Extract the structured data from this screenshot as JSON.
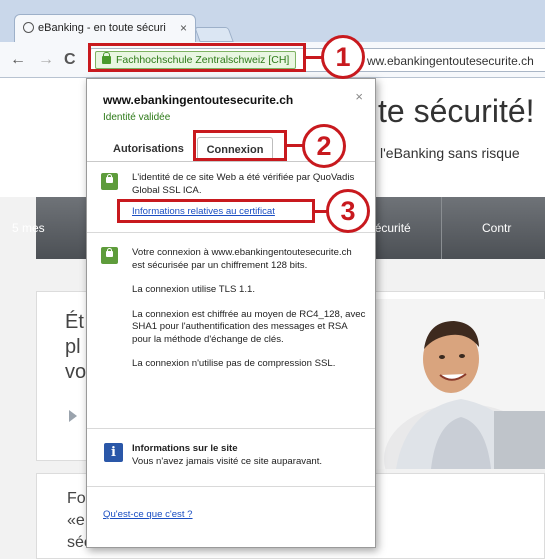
{
  "browser": {
    "tab_title": "eBanking - en toute sécuri",
    "tab_close": "×",
    "ev_label": "Fachhochschule Zentralschweiz [CH]",
    "url_visible": "ww.ebankingentoutesecurite.ch"
  },
  "page": {
    "title": "te sécurité!",
    "subtitle": "l'eBanking sans risque",
    "nav_left": "5 mes",
    "nav_mid": "n à la sécurité",
    "nav_right": "Contr",
    "hero_line1": "Ét",
    "hero_line2": "pl",
    "hero_line3": "vo",
    "section2_line1": "Fo",
    "section2_line2": "«e",
    "section2_line3": "sécurité!»"
  },
  "popup": {
    "domain": "www.ebankingentoutesecurite.ch",
    "close": "×",
    "verified": "Identité validée",
    "tabs": [
      {
        "label": "Autorisations",
        "active": false
      },
      {
        "label": "Connexion",
        "active": true
      }
    ],
    "identity_text": "L'identité de ce site Web a été vérifiée par QuoVadis Global SSL ICA.",
    "cert_link": "Informations relatives au certificat",
    "conn_p1": "Votre connexion à www.ebankingentoutesecurite.ch est sécurisée par un chiffrement 128 bits.",
    "conn_p2": "La connexion utilise TLS 1.1.",
    "conn_p3": "La connexion est chiffrée au moyen de RC4_128, avec SHA1 pour l'authentification des messages et RSA pour la méthode d'échange de clés.",
    "conn_p4": "La connexion n'utilise pas de compression SSL.",
    "site_info_title": "Informations sur le site",
    "site_info_text": "Vous n'avez jamais visité ce site auparavant.",
    "help_link": "Qu'est-ce que c'est ?"
  },
  "callouts": [
    "1",
    "2",
    "3"
  ],
  "colors": {
    "annotation": "#c8191e",
    "ev_green": "#2d7a18",
    "link_blue": "#1a4ec2",
    "lock_green": "#5e9c3b"
  }
}
